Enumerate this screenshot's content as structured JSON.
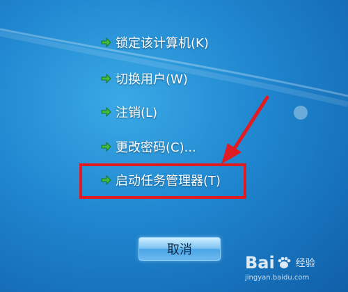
{
  "menu": {
    "items": [
      {
        "label": "锁定该计算机(K)"
      },
      {
        "label": "切换用户(W)"
      },
      {
        "label": "注销(L)"
      },
      {
        "label": "更改密码(C)..."
      },
      {
        "label": "启动任务管理器(T)"
      }
    ],
    "arrow_icon": "green-right-arrow-icon",
    "arrow_color": "#3fbf3f"
  },
  "cancel_button": {
    "label": "取消"
  },
  "annotation": {
    "color": "#e11b22",
    "highlight_target": "启动任务管理器(T)"
  },
  "watermark": {
    "brand_text_left": "Bai",
    "brand_text_right": "经验",
    "url": "jingyan.baidu.com"
  }
}
